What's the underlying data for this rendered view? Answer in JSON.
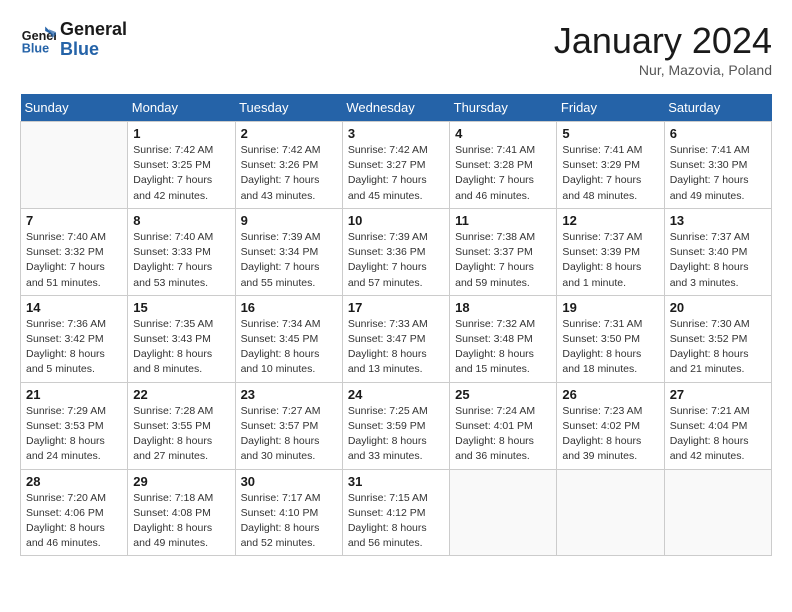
{
  "header": {
    "logo_line1": "General",
    "logo_line2": "Blue",
    "month_title": "January 2024",
    "subtitle": "Nur, Mazovia, Poland"
  },
  "days_of_week": [
    "Sunday",
    "Monday",
    "Tuesday",
    "Wednesday",
    "Thursday",
    "Friday",
    "Saturday"
  ],
  "weeks": [
    [
      {
        "day": "",
        "info": ""
      },
      {
        "day": "1",
        "info": "Sunrise: 7:42 AM\nSunset: 3:25 PM\nDaylight: 7 hours\nand 42 minutes."
      },
      {
        "day": "2",
        "info": "Sunrise: 7:42 AM\nSunset: 3:26 PM\nDaylight: 7 hours\nand 43 minutes."
      },
      {
        "day": "3",
        "info": "Sunrise: 7:42 AM\nSunset: 3:27 PM\nDaylight: 7 hours\nand 45 minutes."
      },
      {
        "day": "4",
        "info": "Sunrise: 7:41 AM\nSunset: 3:28 PM\nDaylight: 7 hours\nand 46 minutes."
      },
      {
        "day": "5",
        "info": "Sunrise: 7:41 AM\nSunset: 3:29 PM\nDaylight: 7 hours\nand 48 minutes."
      },
      {
        "day": "6",
        "info": "Sunrise: 7:41 AM\nSunset: 3:30 PM\nDaylight: 7 hours\nand 49 minutes."
      }
    ],
    [
      {
        "day": "7",
        "info": "Sunrise: 7:40 AM\nSunset: 3:32 PM\nDaylight: 7 hours\nand 51 minutes."
      },
      {
        "day": "8",
        "info": "Sunrise: 7:40 AM\nSunset: 3:33 PM\nDaylight: 7 hours\nand 53 minutes."
      },
      {
        "day": "9",
        "info": "Sunrise: 7:39 AM\nSunset: 3:34 PM\nDaylight: 7 hours\nand 55 minutes."
      },
      {
        "day": "10",
        "info": "Sunrise: 7:39 AM\nSunset: 3:36 PM\nDaylight: 7 hours\nand 57 minutes."
      },
      {
        "day": "11",
        "info": "Sunrise: 7:38 AM\nSunset: 3:37 PM\nDaylight: 7 hours\nand 59 minutes."
      },
      {
        "day": "12",
        "info": "Sunrise: 7:37 AM\nSunset: 3:39 PM\nDaylight: 8 hours\nand 1 minute."
      },
      {
        "day": "13",
        "info": "Sunrise: 7:37 AM\nSunset: 3:40 PM\nDaylight: 8 hours\nand 3 minutes."
      }
    ],
    [
      {
        "day": "14",
        "info": "Sunrise: 7:36 AM\nSunset: 3:42 PM\nDaylight: 8 hours\nand 5 minutes."
      },
      {
        "day": "15",
        "info": "Sunrise: 7:35 AM\nSunset: 3:43 PM\nDaylight: 8 hours\nand 8 minutes."
      },
      {
        "day": "16",
        "info": "Sunrise: 7:34 AM\nSunset: 3:45 PM\nDaylight: 8 hours\nand 10 minutes."
      },
      {
        "day": "17",
        "info": "Sunrise: 7:33 AM\nSunset: 3:47 PM\nDaylight: 8 hours\nand 13 minutes."
      },
      {
        "day": "18",
        "info": "Sunrise: 7:32 AM\nSunset: 3:48 PM\nDaylight: 8 hours\nand 15 minutes."
      },
      {
        "day": "19",
        "info": "Sunrise: 7:31 AM\nSunset: 3:50 PM\nDaylight: 8 hours\nand 18 minutes."
      },
      {
        "day": "20",
        "info": "Sunrise: 7:30 AM\nSunset: 3:52 PM\nDaylight: 8 hours\nand 21 minutes."
      }
    ],
    [
      {
        "day": "21",
        "info": "Sunrise: 7:29 AM\nSunset: 3:53 PM\nDaylight: 8 hours\nand 24 minutes."
      },
      {
        "day": "22",
        "info": "Sunrise: 7:28 AM\nSunset: 3:55 PM\nDaylight: 8 hours\nand 27 minutes."
      },
      {
        "day": "23",
        "info": "Sunrise: 7:27 AM\nSunset: 3:57 PM\nDaylight: 8 hours\nand 30 minutes."
      },
      {
        "day": "24",
        "info": "Sunrise: 7:25 AM\nSunset: 3:59 PM\nDaylight: 8 hours\nand 33 minutes."
      },
      {
        "day": "25",
        "info": "Sunrise: 7:24 AM\nSunset: 4:01 PM\nDaylight: 8 hours\nand 36 minutes."
      },
      {
        "day": "26",
        "info": "Sunrise: 7:23 AM\nSunset: 4:02 PM\nDaylight: 8 hours\nand 39 minutes."
      },
      {
        "day": "27",
        "info": "Sunrise: 7:21 AM\nSunset: 4:04 PM\nDaylight: 8 hours\nand 42 minutes."
      }
    ],
    [
      {
        "day": "28",
        "info": "Sunrise: 7:20 AM\nSunset: 4:06 PM\nDaylight: 8 hours\nand 46 minutes."
      },
      {
        "day": "29",
        "info": "Sunrise: 7:18 AM\nSunset: 4:08 PM\nDaylight: 8 hours\nand 49 minutes."
      },
      {
        "day": "30",
        "info": "Sunrise: 7:17 AM\nSunset: 4:10 PM\nDaylight: 8 hours\nand 52 minutes."
      },
      {
        "day": "31",
        "info": "Sunrise: 7:15 AM\nSunset: 4:12 PM\nDaylight: 8 hours\nand 56 minutes."
      },
      {
        "day": "",
        "info": ""
      },
      {
        "day": "",
        "info": ""
      },
      {
        "day": "",
        "info": ""
      }
    ]
  ]
}
